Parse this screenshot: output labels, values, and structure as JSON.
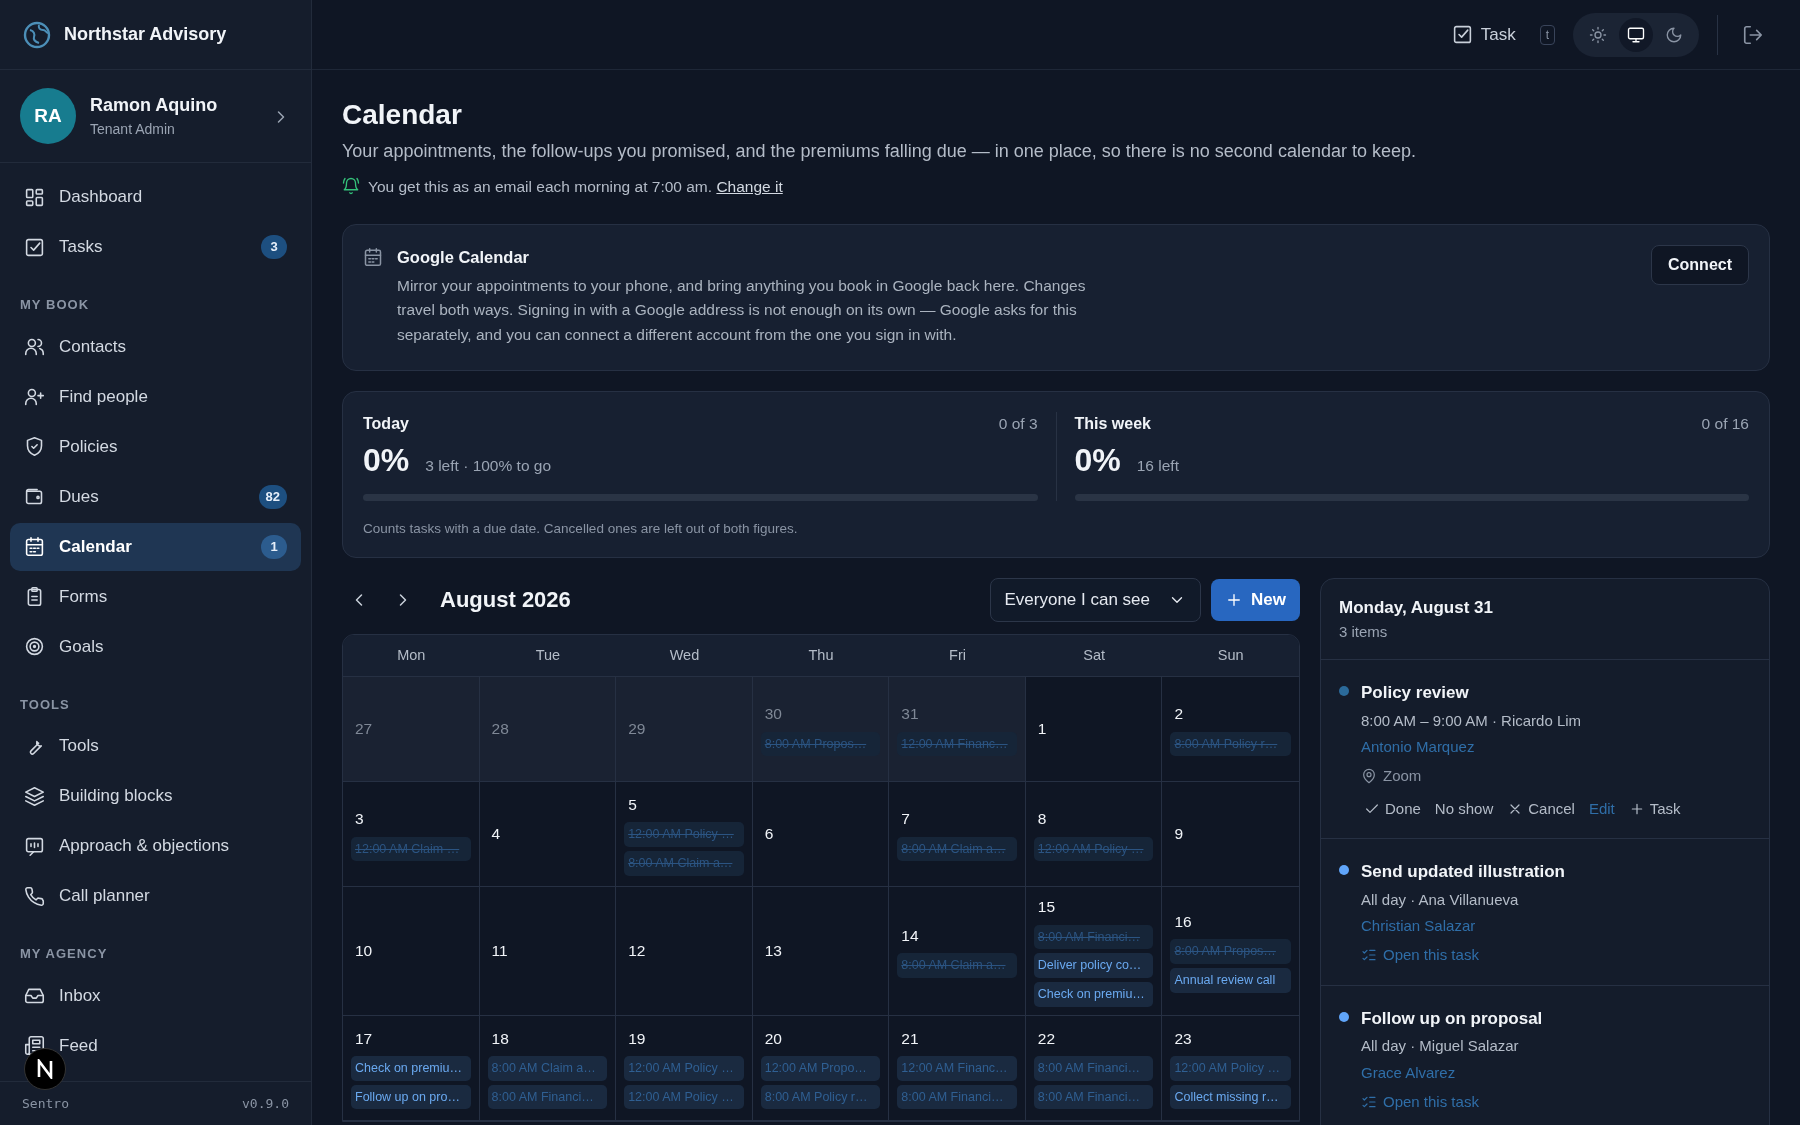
{
  "brand": {
    "name": "Northstar Advisory"
  },
  "user": {
    "initials": "RA",
    "name": "Ramon Aquino",
    "role": "Tenant Admin"
  },
  "sidebar": {
    "sections": [
      {
        "items": [
          {
            "label": "Dashboard",
            "selected": false
          },
          {
            "label": "Tasks",
            "badge": "3",
            "selected": false
          }
        ]
      },
      {
        "label": "MY BOOK",
        "items": [
          {
            "label": "Contacts",
            "selected": false
          },
          {
            "label": "Find people",
            "selected": false
          },
          {
            "label": "Policies",
            "selected": false
          },
          {
            "label": "Dues",
            "badge": "82",
            "selected": false
          },
          {
            "label": "Calendar",
            "badge": "1",
            "selected": true
          },
          {
            "label": "Forms",
            "selected": false
          },
          {
            "label": "Goals",
            "selected": false
          }
        ]
      },
      {
        "label": "TOOLS",
        "items": [
          {
            "label": "Tools",
            "selected": false
          },
          {
            "label": "Building blocks",
            "selected": false
          },
          {
            "label": "Approach & objections",
            "selected": false
          },
          {
            "label": "Call planner",
            "selected": false
          }
        ]
      },
      {
        "label": "MY AGENCY",
        "items": [
          {
            "label": "Inbox",
            "selected": false
          },
          {
            "label": "Feed",
            "selected": false
          }
        ]
      }
    ],
    "footer": {
      "product": "Sentro",
      "version": "v0.9.0"
    }
  },
  "topbar": {
    "task_button": "Task",
    "shortcut": "t",
    "theme": [
      {
        "selected": false
      },
      {
        "selected": true
      },
      {
        "selected": false
      }
    ]
  },
  "header": {
    "title": "Calendar",
    "subtitle": "Your appointments, the follow-ups you promised, and the premiums falling due — in one place, so there is no second calendar to keep.",
    "notice": "You get this as an email each morning at 7:00 am.",
    "notice_link": "Change it"
  },
  "google": {
    "title": "Google Calendar",
    "text": "Mirror your appointments to your phone, and bring anything you book in Google back here. Changes travel both ways. Signing in with a Google address is not enough on its own — Google asks for this separately, and you can connect a different account from the one you sign in with.",
    "button": "Connect"
  },
  "progress": {
    "panels": [
      {
        "label": "Today",
        "count": "0 of 3",
        "percent": "0%",
        "detail": "3 left · 100% to go",
        "level": 0
      },
      {
        "label": "This week",
        "count": "0 of 16",
        "percent": "0%",
        "detail": "16 left",
        "level": 0
      }
    ],
    "note": "Counts tasks with a due date. Cancelled ones are left out of both figures."
  },
  "calendar": {
    "month": "August 2026",
    "filter": "Everyone I can see",
    "new_button": "New",
    "weekdays": [
      "Mon",
      "Tue",
      "Wed",
      "Thu",
      "Fri",
      "Sat",
      "Sun"
    ],
    "weeks": [
      [
        {
          "day": "27",
          "outside": true
        },
        {
          "day": "28",
          "outside": true
        },
        {
          "day": "29",
          "outside": true
        },
        {
          "day": "30",
          "outside": true,
          "events": [
            {
              "text": "8:00 AM Propos…",
              "cancelled": true,
              "past": true
            }
          ]
        },
        {
          "day": "31",
          "outside": true,
          "events": [
            {
              "text": "12:00 AM Financ…",
              "cancelled": true,
              "past": true
            }
          ]
        },
        {
          "day": "1",
          "outside": false
        },
        {
          "day": "2",
          "outside": false,
          "events": [
            {
              "text": "8:00 AM Policy r…",
              "cancelled": true,
              "past": true
            }
          ]
        }
      ],
      [
        {
          "day": "3",
          "outside": false,
          "events": [
            {
              "text": "12:00 AM Claim …",
              "cancelled": true,
              "past": true
            }
          ]
        },
        {
          "day": "4",
          "outside": false
        },
        {
          "day": "5",
          "outside": false,
          "events": [
            {
              "text": "12:00 AM Policy …",
              "cancelled": true,
              "past": true
            },
            {
              "text": "8:00 AM Claim a…",
              "cancelled": true,
              "past": true
            }
          ]
        },
        {
          "day": "6",
          "outside": false
        },
        {
          "day": "7",
          "outside": false,
          "events": [
            {
              "text": "8:00 AM Claim a…",
              "cancelled": true,
              "past": true
            }
          ]
        },
        {
          "day": "8",
          "outside": false,
          "events": [
            {
              "text": "12:00 AM Policy …",
              "cancelled": true,
              "past": true
            }
          ]
        },
        {
          "day": "9",
          "outside": false
        }
      ],
      [
        {
          "day": "10",
          "outside": false
        },
        {
          "day": "11",
          "outside": false
        },
        {
          "day": "12",
          "outside": false
        },
        {
          "day": "13",
          "outside": false
        },
        {
          "day": "14",
          "outside": false,
          "events": [
            {
              "text": "8:00 AM Claim a…",
              "cancelled": true,
              "past": true
            }
          ]
        },
        {
          "day": "15",
          "outside": false,
          "events": [
            {
              "text": "8:00 AM Financi…",
              "cancelled": true,
              "past": true
            },
            {
              "text": "Deliver policy co…",
              "cancelled": false,
              "past": false
            },
            {
              "text": "Check on premiu…",
              "cancelled": false,
              "past": false
            }
          ]
        },
        {
          "day": "16",
          "outside": false,
          "events": [
            {
              "text": "8:00 AM Propos…",
              "cancelled": true,
              "past": true
            },
            {
              "text": "Annual review call",
              "cancelled": false,
              "past": false
            }
          ]
        }
      ],
      [
        {
          "day": "17",
          "outside": false,
          "events": [
            {
              "text": "Check on premiu…",
              "cancelled": false,
              "past": false
            },
            {
              "text": "Follow up on pro…",
              "cancelled": false,
              "past": false
            }
          ]
        },
        {
          "day": "18",
          "outside": false,
          "events": [
            {
              "text": "8:00 AM Claim a…",
              "cancelled": false,
              "past": true
            },
            {
              "text": "8:00 AM Financi…",
              "cancelled": false,
              "past": true
            }
          ]
        },
        {
          "day": "19",
          "outside": false,
          "events": [
            {
              "text": "12:00 AM Policy …",
              "cancelled": false,
              "past": true
            },
            {
              "text": "12:00 AM Policy …",
              "cancelled": false,
              "past": true
            }
          ]
        },
        {
          "day": "20",
          "outside": false,
          "events": [
            {
              "text": "12:00 AM Propo…",
              "cancelled": false,
              "past": true
            },
            {
              "text": "8:00 AM Policy r…",
              "cancelled": false,
              "past": true
            }
          ]
        },
        {
          "day": "21",
          "outside": false,
          "events": [
            {
              "text": "12:00 AM Financ…",
              "cancelled": false,
              "past": true
            },
            {
              "text": "8:00 AM Financi…",
              "cancelled": false,
              "past": true
            }
          ]
        },
        {
          "day": "22",
          "outside": false,
          "events": [
            {
              "text": "8:00 AM Financi…",
              "cancelled": false,
              "past": true
            },
            {
              "text": "8:00 AM Financi…",
              "cancelled": false,
              "past": true
            }
          ]
        },
        {
          "day": "23",
          "outside": false,
          "events": [
            {
              "text": "12:00 AM Policy …",
              "cancelled": false,
              "past": true
            },
            {
              "text": "Collect missing r…",
              "cancelled": false,
              "past": false
            }
          ]
        }
      ]
    ]
  },
  "day_panel": {
    "title": "Monday, August 31",
    "count": "3 items",
    "items": [
      {
        "kind": "appointment",
        "color": "#2b6a9a",
        "title": "Policy review",
        "meta": "8:00 AM – 9:00 AM · Ricardo Lim",
        "client": "Antonio Marquez",
        "location": "Zoom",
        "actions": [
          "Done",
          "No show",
          "Cancel",
          "Edit",
          "Task"
        ]
      },
      {
        "kind": "task",
        "color": "#60a5fa",
        "title": "Send updated illustration",
        "meta": "All day · Ana Villanueva",
        "client": "Christian Salazar",
        "link": "Open this task"
      },
      {
        "kind": "task",
        "color": "#60a5fa",
        "title": "Follow up on proposal",
        "meta": "All day · Miguel Salazar",
        "client": "Grace Alvarez",
        "link": "Open this task"
      }
    ]
  }
}
